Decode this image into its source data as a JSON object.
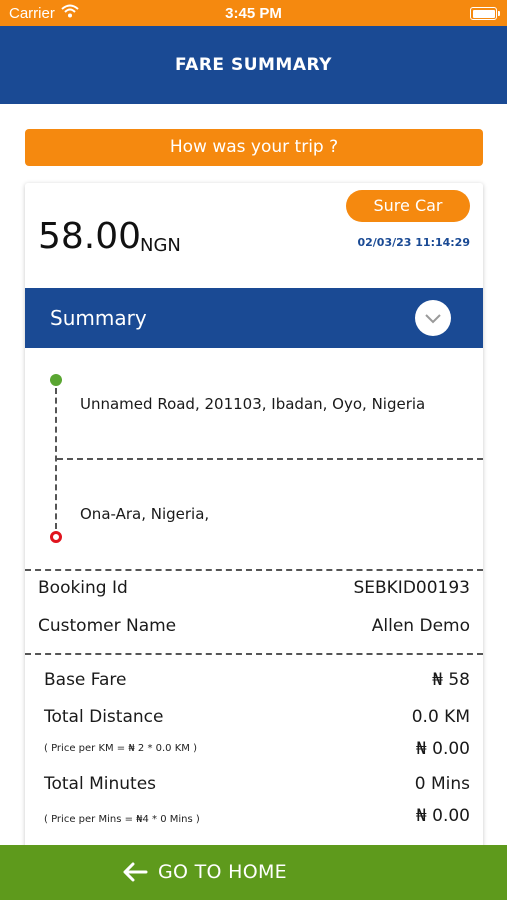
{
  "status_bar": {
    "carrier": "Carrier",
    "time": "3:45 PM"
  },
  "header": {
    "title": "FARE SUMMARY"
  },
  "rate_prompt": "How was your trip ?",
  "fare": {
    "amount": "58.00",
    "currency": "NGN",
    "car_type": "Sure Car",
    "date_time": "02/03/23 11:14:29"
  },
  "summary": {
    "title": "Summary"
  },
  "route": {
    "pickup": "Unnamed Road, 201103, Ibadan, Oyo, Nigeria",
    "dropoff": "Ona-Ara, Nigeria,"
  },
  "booking": {
    "booking_id_label": "Booking Id",
    "booking_id": "SEBKID00193",
    "customer_label": "Customer Name",
    "customer": "Allen Demo"
  },
  "fare_details": {
    "base_fare_label": "Base Fare",
    "base_fare": "₦ 58",
    "distance_label": "Total Distance",
    "distance": "0.0 KM",
    "distance_note": "( Price per KM = ₦ 2 * 0.0 KM )",
    "distance_price": "₦ 0.00",
    "minutes_label": "Total Minutes",
    "minutes": "0 Mins",
    "minutes_note": "( Price per Mins = ₦4 * 0 Mins )",
    "minutes_price": "₦ 0.00"
  },
  "footer": {
    "go_home_label": "GO TO HOME"
  },
  "colors": {
    "orange": "#f5890f",
    "navy": "#1a4a94",
    "green": "#5e9a1c",
    "pickup_dot": "#5aa632",
    "dropoff_dot": "#e0141e"
  }
}
